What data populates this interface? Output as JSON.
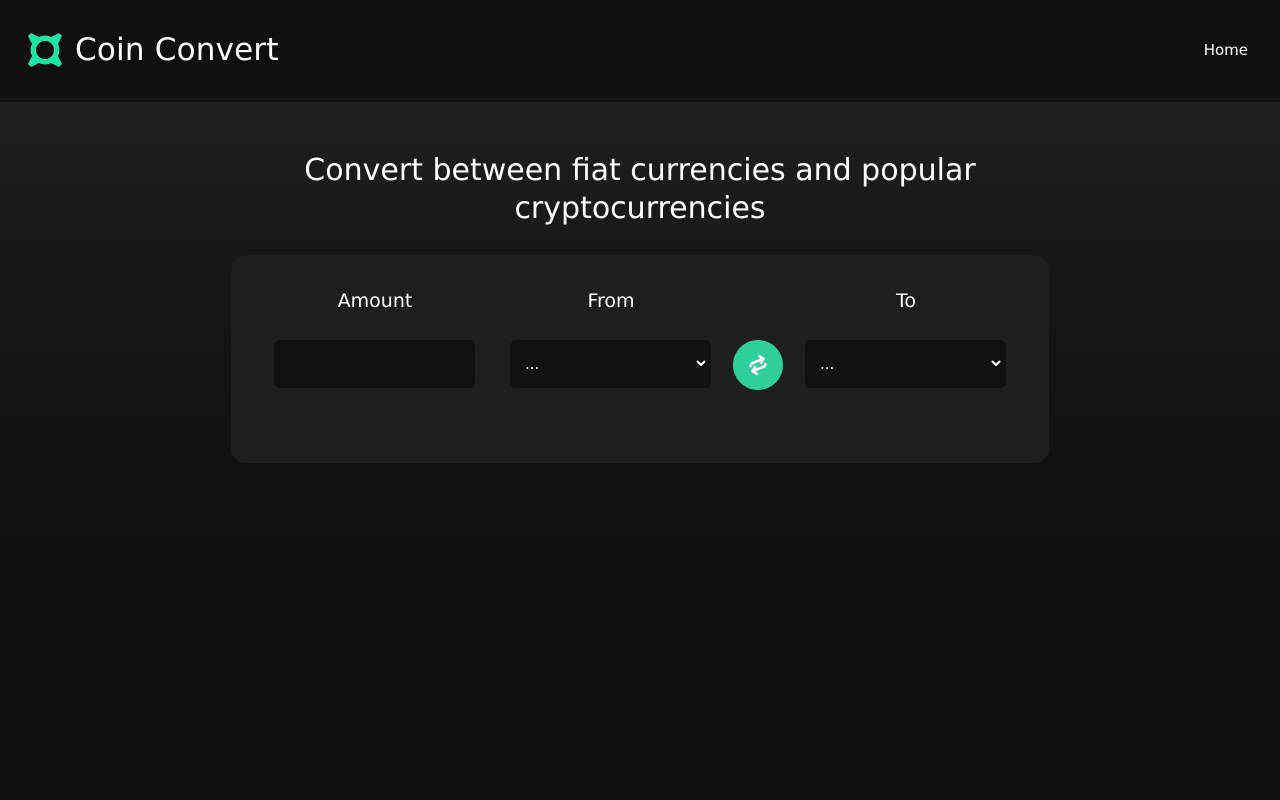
{
  "brand": {
    "name": "Coin Convert",
    "logo_icon": "coin-logo-icon",
    "accent_color": "#1ee3a4"
  },
  "nav": {
    "home_label": "Home"
  },
  "headline": "Convert between fiat currencies and popular cryptocurrencies",
  "converter": {
    "amount": {
      "label": "Amount",
      "value": "",
      "placeholder": ""
    },
    "from": {
      "label": "From",
      "selected": "..."
    },
    "to": {
      "label": "To",
      "selected": "..."
    },
    "swap_icon": "swap-arrows-icon",
    "swap_color": "#2fcf9b"
  }
}
